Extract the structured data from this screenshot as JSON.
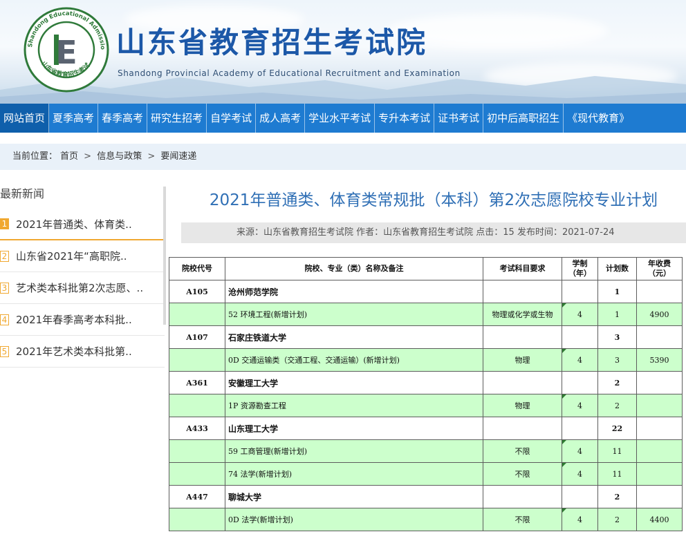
{
  "header": {
    "title": "山东省教育招生考试院",
    "subtitle": "Shandong Provincial Academy of Educational Recruitment and Examination",
    "logo_ring_text": "Shandong Educational Admission & Examinations",
    "logo_bottom_text": "山东省教育招生考试",
    "logo_letter": "E"
  },
  "nav": {
    "items": [
      "网站首页",
      "夏季高考",
      "春季高考",
      "研究生招考",
      "自学考试",
      "成人高考",
      "学业水平考试",
      "专升本考试",
      "证书考试",
      "初中后高职招生",
      "《现代教育》"
    ]
  },
  "breadcrumb": {
    "label": "当前位置：",
    "items": [
      "首页",
      "信息与政策",
      "要闻速递"
    ],
    "separator": ">"
  },
  "sidebar": {
    "title": "最新新闻",
    "items": [
      {
        "num": "1",
        "text": "2021年普通类、体育类.."
      },
      {
        "num": "2",
        "text": "山东省2021年“高职院.."
      },
      {
        "num": "3",
        "text": "艺术类本科批第2次志愿、.."
      },
      {
        "num": "4",
        "text": "2021年春季高考本科批.."
      },
      {
        "num": "5",
        "text": "2021年艺术类本科批第.."
      }
    ]
  },
  "article": {
    "title": "2021年普通类、体育类常规批（本科）第2次志愿院校专业计划",
    "meta": "来源：山东省教育招生考试院 作者：山东省教育招生考试院 点击：15 发布时间：2021-07-24"
  },
  "table": {
    "headers": {
      "code": "院校代号",
      "name": "院校、专业（类）名称及备注",
      "subject": "考试科目要求",
      "years": "学制（年）",
      "plan": "计划数",
      "fee": "年收费（元）"
    },
    "rows": [
      {
        "type": "uni",
        "code": "A105",
        "name": "沧州师范学院",
        "subject": "",
        "years": "",
        "plan": "1",
        "fee": ""
      },
      {
        "type": "major",
        "code": "",
        "name": "52 环境工程(新增计划)",
        "subject": "物理或化学或生物",
        "years": "4",
        "plan": "1",
        "fee": "4900"
      },
      {
        "type": "uni",
        "code": "A107",
        "name": "石家庄铁道大学",
        "subject": "",
        "years": "",
        "plan": "3",
        "fee": ""
      },
      {
        "type": "major",
        "code": "",
        "name": "0D 交通运输类（交通工程、交通运输）(新增计划)",
        "subject": "物理",
        "years": "4",
        "plan": "3",
        "fee": "5390"
      },
      {
        "type": "uni",
        "code": "A361",
        "name": "安徽理工大学",
        "subject": "",
        "years": "",
        "plan": "2",
        "fee": ""
      },
      {
        "type": "major",
        "code": "",
        "name": "1P 资源勘查工程",
        "subject": "物理",
        "years": "4",
        "plan": "2",
        "fee": ""
      },
      {
        "type": "uni",
        "code": "A433",
        "name": "山东理工大学",
        "subject": "",
        "years": "",
        "plan": "22",
        "fee": ""
      },
      {
        "type": "major",
        "code": "",
        "name": "59 工商管理(新增计划)",
        "subject": "不限",
        "years": "4",
        "plan": "11",
        "fee": ""
      },
      {
        "type": "major",
        "code": "",
        "name": "74 法学(新增计划)",
        "subject": "不限",
        "years": "4",
        "plan": "11",
        "fee": ""
      },
      {
        "type": "uni",
        "code": "A447",
        "name": "聊城大学",
        "subject": "",
        "years": "",
        "plan": "2",
        "fee": ""
      },
      {
        "type": "major",
        "code": "",
        "name": "0D 法学(新增计划)",
        "subject": "不限",
        "years": "4",
        "plan": "2",
        "fee": "4400"
      }
    ]
  },
  "colors": {
    "brand_blue": "#1c58a8",
    "nav_blue": "#1e7bd1",
    "nav_active": "#0f5fab",
    "accent_orange": "#f0a830",
    "title_blue": "#2f6fb5",
    "major_row_green": "#ccffcc"
  }
}
